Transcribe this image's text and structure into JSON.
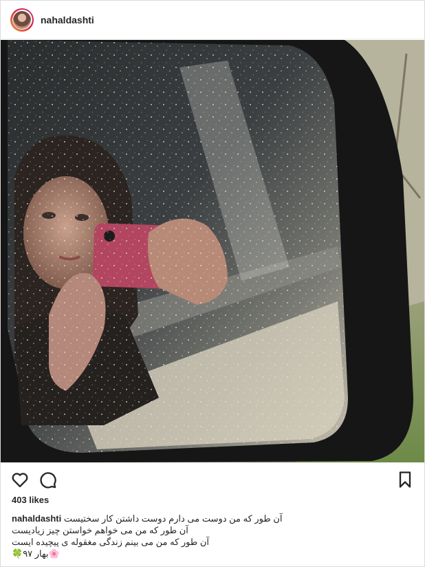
{
  "post": {
    "username": "nahaldashti",
    "likes": "403 likes",
    "caption": {
      "username": "nahaldashti",
      "lines": [
        "آن طور که من دوست می دارم دوست داشتن کار سختیست",
        "آن طور که من می خواهم خواستن چیز زیادیست",
        "آن طور که من می بینم زندگی مغقوله ی پیچیده ایست",
        "🌸بهار ۹۷🍀"
      ]
    }
  },
  "icons": [
    "avatar",
    "heart-icon",
    "comment-icon",
    "bookmark-icon"
  ],
  "colors": {
    "text": "#262626",
    "border": "#dbdbdb",
    "background": "#ffffff"
  }
}
